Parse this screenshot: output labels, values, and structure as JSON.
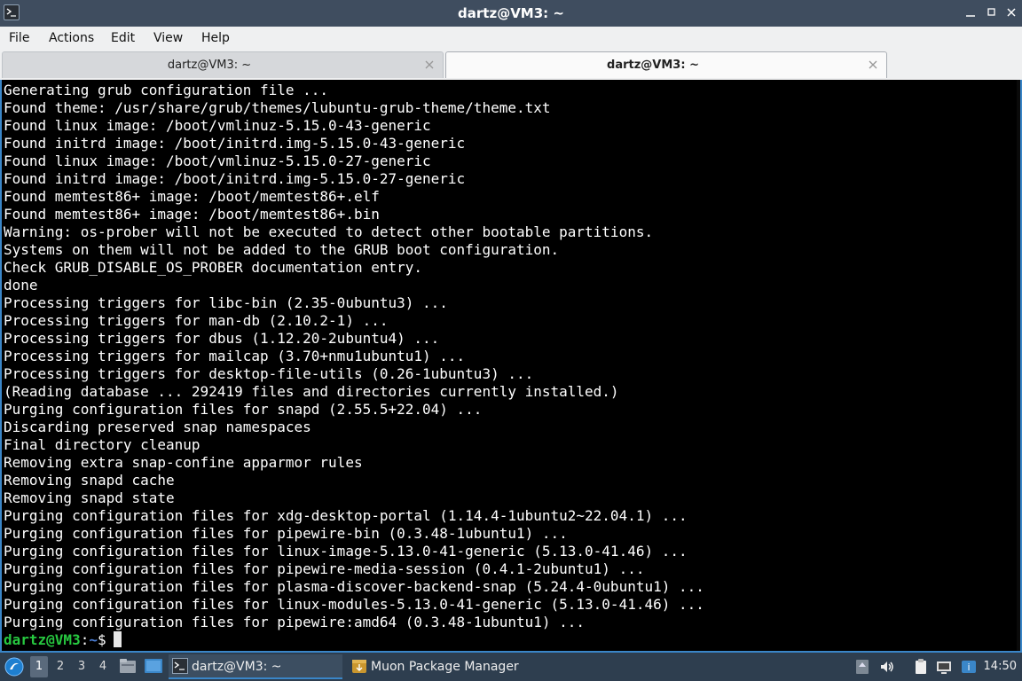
{
  "window": {
    "title": "dartz@VM3: ~"
  },
  "menu": [
    "File",
    "Actions",
    "Edit",
    "View",
    "Help"
  ],
  "tabs": [
    {
      "label": "dartz@VM3: ~",
      "active": false
    },
    {
      "label": "dartz@VM3: ~",
      "active": true
    }
  ],
  "terminal": {
    "lines": [
      "Generating grub configuration file ...",
      "Found theme: /usr/share/grub/themes/lubuntu-grub-theme/theme.txt",
      "Found linux image: /boot/vmlinuz-5.15.0-43-generic",
      "Found initrd image: /boot/initrd.img-5.15.0-43-generic",
      "Found linux image: /boot/vmlinuz-5.15.0-27-generic",
      "Found initrd image: /boot/initrd.img-5.15.0-27-generic",
      "Found memtest86+ image: /boot/memtest86+.elf",
      "Found memtest86+ image: /boot/memtest86+.bin",
      "Warning: os-prober will not be executed to detect other bootable partitions.",
      "Systems on them will not be added to the GRUB boot configuration.",
      "Check GRUB_DISABLE_OS_PROBER documentation entry.",
      "done",
      "Processing triggers for libc-bin (2.35-0ubuntu3) ...",
      "Processing triggers for man-db (2.10.2-1) ...",
      "Processing triggers for dbus (1.12.20-2ubuntu4) ...",
      "Processing triggers for mailcap (3.70+nmu1ubuntu1) ...",
      "Processing triggers for desktop-file-utils (0.26-1ubuntu3) ...",
      "(Reading database ... 292419 files and directories currently installed.)",
      "Purging configuration files for snapd (2.55.5+22.04) ...",
      "Discarding preserved snap namespaces",
      "Final directory cleanup",
      "Removing extra snap-confine apparmor rules",
      "Removing snapd cache",
      "Removing snapd state",
      "Purging configuration files for xdg-desktop-portal (1.14.4-1ubuntu2~22.04.1) ...",
      "Purging configuration files for pipewire-bin (0.3.48-1ubuntu1) ...",
      "Purging configuration files for linux-image-5.13.0-41-generic (5.13.0-41.46) ...",
      "Purging configuration files for pipewire-media-session (0.4.1-2ubuntu1) ...",
      "Purging configuration files for plasma-discover-backend-snap (5.24.4-0ubuntu1) ...",
      "Purging configuration files for linux-modules-5.13.0-41-generic (5.13.0-41.46) ...",
      "Purging configuration files for pipewire:amd64 (0.3.48-1ubuntu1) ..."
    ],
    "prompt": {
      "user": "dartz@VM3",
      "sep": ":",
      "path": "~",
      "symbol": "$"
    }
  },
  "taskbar": {
    "workspaces": [
      "1",
      "2",
      "3",
      "4"
    ],
    "active_workspace": "1",
    "tasks": [
      {
        "label": "dartz@VM3: ~",
        "icon": "terminal-icon"
      },
      {
        "label": "Muon Package Manager",
        "icon": "package-icon"
      }
    ],
    "clock": "14:50"
  },
  "colors": {
    "prompt_user": "#27c840",
    "prompt_path": "#4b7fd6",
    "accent": "#3a86c8"
  }
}
